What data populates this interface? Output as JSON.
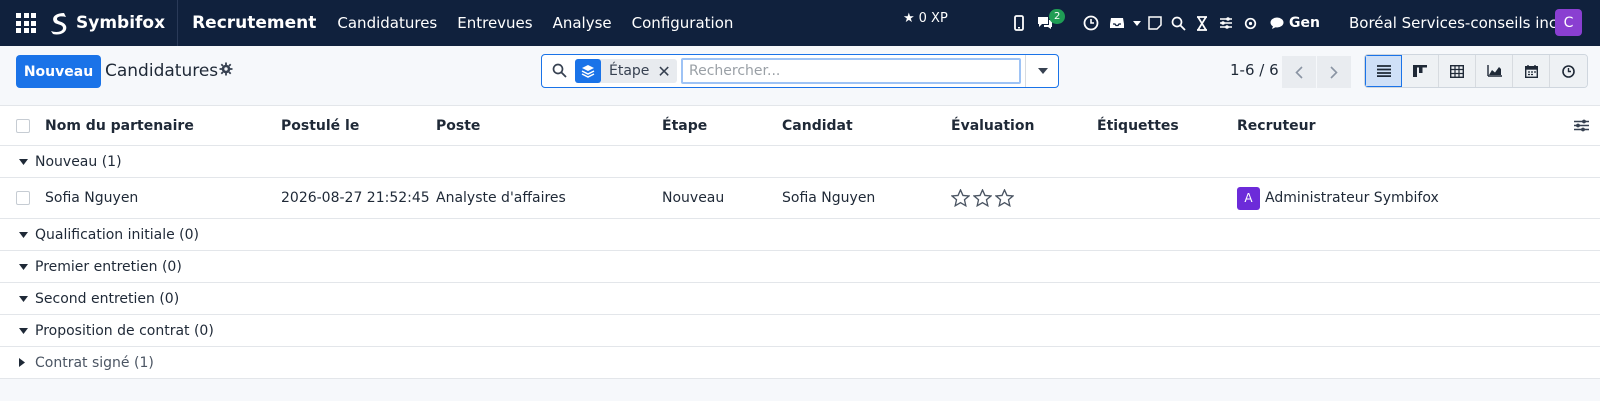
{
  "navbar": {
    "brand": "Symbifox",
    "module": "Recrutement",
    "menu": [
      "Candidatures",
      "Entrevues",
      "Analyse",
      "Configuration"
    ],
    "xp": "0 XP",
    "messages_badge": "2",
    "user_short": "Gen",
    "company": "Boréal Services-conseils inc.",
    "avatar_letter": "C",
    "avatar_color": "#8a3fd1"
  },
  "control_panel": {
    "new_button": "Nouveau",
    "title": "Candidatures",
    "facet_label": "Étape",
    "search_placeholder": "Rechercher...",
    "pager": "1-6 / 6",
    "views": [
      "list-view-icon",
      "kanban-view-icon",
      "pivot-view-icon",
      "graph-view-icon",
      "calendar-view-icon",
      "activity-view-icon"
    ]
  },
  "table": {
    "columns": [
      "Nom du partenaire",
      "Postulé le",
      "Poste",
      "Étape",
      "Candidat",
      "Évaluation",
      "Étiquettes",
      "Recruteur"
    ],
    "groups": [
      {
        "label": "Nouveau (1)",
        "expanded": true
      },
      {
        "label": "Qualification initiale (0)",
        "expanded": true
      },
      {
        "label": "Premier entretien (0)",
        "expanded": true
      },
      {
        "label": "Second entretien (0)",
        "expanded": true
      },
      {
        "label": "Proposition de contrat (0)",
        "expanded": true
      },
      {
        "label": "Contrat signé (1)",
        "expanded": false
      }
    ],
    "record": {
      "partner": "Sofia Nguyen",
      "applied_on": "2026-08-27 21:52:45",
      "job": "Analyste d'affaires",
      "stage": "Nouveau",
      "candidate": "Sofia Nguyen",
      "rating": 0,
      "rating_max": 3,
      "tags": "",
      "recruiter_initial": "A",
      "recruiter": "Administrateur Symbifox"
    }
  },
  "colors": {
    "navbar": "#10213d",
    "primary": "#1a73e8",
    "recruiter_avatar": "#6c2bd9"
  }
}
